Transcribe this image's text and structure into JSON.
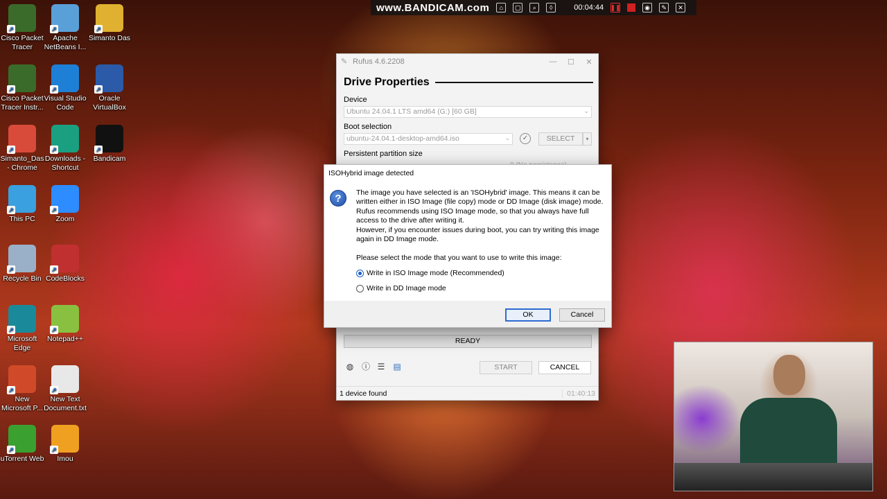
{
  "desktop": {
    "icons": [
      {
        "label": "Cisco Packet Tracer",
        "icon": "cisco-packet-tracer-icon",
        "color": "#3a6b2a"
      },
      {
        "label": "Apache NetBeans I...",
        "icon": "netbeans-icon",
        "color": "#5aa0d8"
      },
      {
        "label": "Simanto Das",
        "icon": "user-folder-icon",
        "color": "#e0b030"
      },
      {
        "label": "Cisco Packet Tracer Instr...",
        "icon": "cisco-packet-tracer-instructor-icon",
        "color": "#3a6b2a"
      },
      {
        "label": "Visual Studio Code",
        "icon": "vscode-icon",
        "color": "#1e7fd6"
      },
      {
        "label": "Oracle VirtualBox",
        "icon": "virtualbox-icon",
        "color": "#2a5aa8"
      },
      {
        "label": "Simanto_Das - Chrome",
        "icon": "chrome-icon",
        "color": "#d84a3a"
      },
      {
        "label": "Downloads - Shortcut",
        "icon": "downloads-folder-icon",
        "color": "#1aa080"
      },
      {
        "label": "Bandicam",
        "icon": "bandicam-icon",
        "color": "#111111"
      },
      {
        "label": "This PC",
        "icon": "this-pc-icon",
        "color": "#3aa0e0"
      },
      {
        "label": "Zoom",
        "icon": "zoom-icon",
        "color": "#2d8cff"
      },
      {
        "label": "Recycle Bin",
        "icon": "recycle-bin-icon",
        "color": "#9ab0c8"
      },
      {
        "label": "CodeBlocks",
        "icon": "codeblocks-icon",
        "color": "#c03030"
      },
      {
        "label": "Microsoft Edge",
        "icon": "edge-icon",
        "color": "#1a8a9a"
      },
      {
        "label": "Notepad++",
        "icon": "notepadpp-icon",
        "color": "#8ac040"
      },
      {
        "label": "New Microsoft P...",
        "icon": "powerpoint-icon",
        "color": "#d04a2a"
      },
      {
        "label": "New Text Document.txt",
        "icon": "text-document-icon",
        "color": "#e8e8e8"
      },
      {
        "label": "uTorrent Web",
        "icon": "utorrent-icon",
        "color": "#3aa030"
      },
      {
        "label": "Imou",
        "icon": "imou-icon",
        "color": "#f0a020"
      }
    ]
  },
  "bandicam": {
    "brand": "www.BANDICAM.com",
    "elapsed": "00:04:44"
  },
  "rufus": {
    "title": "Rufus 4.6.2208",
    "section": "Drive Properties",
    "device_label": "Device",
    "device_value": "Ubuntu 24.04.1 LTS amd64 (G:) [60 GB]",
    "boot_label": "Boot selection",
    "boot_value": "ubuntu-24.04.1-desktop-amd64.iso",
    "select_label": "SELECT",
    "persistent_label": "Persistent partition size",
    "persistent_value": "0 (No persistence)",
    "status": "READY",
    "start_label": "START",
    "cancel_label": "CANCEL",
    "footer_status": "1 device found",
    "footer_elapsed": "01:40:13"
  },
  "dialog": {
    "title": "ISOHybrid image detected",
    "message_1": "The image you have selected is an 'ISOHybrid' image. This means it can be written either in ISO Image (file copy) mode or DD Image (disk image) mode. Rufus recommends using ISO Image mode, so that you always have full access to the drive after writing it.",
    "message_2": "However, if you encounter issues during boot, you can try writing this image again in DD Image mode.",
    "prompt": "Please select the mode that you want to use to write this image:",
    "option_iso": "Write in ISO Image mode (Recommended)",
    "option_dd": "Write in DD Image mode",
    "selected_option": "iso",
    "ok_label": "OK",
    "cancel_label": "Cancel"
  }
}
